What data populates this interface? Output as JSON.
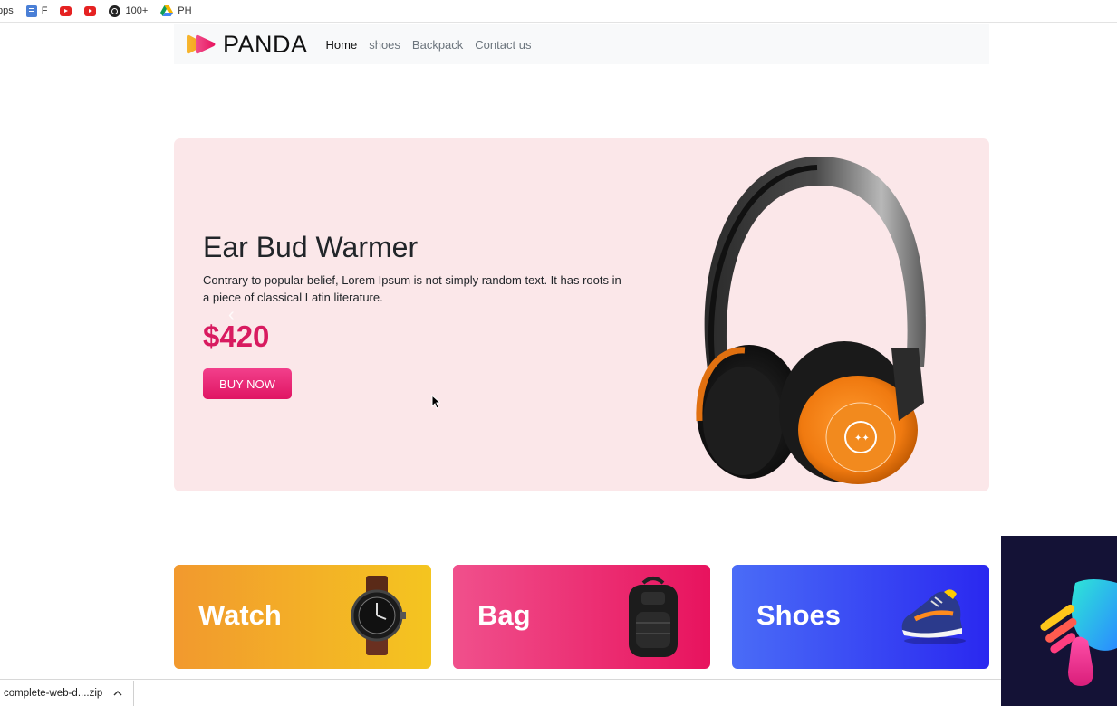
{
  "bookmarks": [
    {
      "label": "pps",
      "icon": "apps-icon"
    },
    {
      "label": "F",
      "icon": "docs-icon"
    },
    {
      "label": "",
      "icon": "youtube-icon"
    },
    {
      "label": "",
      "icon": "youtube-icon"
    },
    {
      "label": "100+",
      "icon": "github-icon"
    },
    {
      "label": "PH",
      "icon": "drive-icon"
    }
  ],
  "nav": {
    "brand": "PANDA",
    "links": [
      "Home",
      "shoes",
      "Backpack",
      "Contact us"
    ],
    "active": "Home"
  },
  "hero": {
    "title": "Ear Bud Warmer",
    "description": "Contrary to popular belief, Lorem Ipsum is not simply random text. It has roots in a piece of classical Latin literature.",
    "price": "$420",
    "button": "BUY NOW",
    "prev_icon": "chevron-left-icon",
    "next_icon": "chevron-right-icon"
  },
  "categories": [
    {
      "label": "Watch",
      "colors": [
        "#f2992e",
        "#f4c520"
      ]
    },
    {
      "label": "Bag",
      "colors": [
        "#f0508c",
        "#e8135e"
      ]
    },
    {
      "label": "Shoes",
      "colors": [
        "#4a6cf7",
        "#2a28f0"
      ]
    }
  ],
  "download": {
    "filename": "complete-web-d....zip",
    "menu_icon": "chevron-up-icon"
  },
  "colors": {
    "accent": "#d81b60",
    "hero_bg": "#fbe7e9",
    "navbar_bg": "#f8f9fa"
  }
}
